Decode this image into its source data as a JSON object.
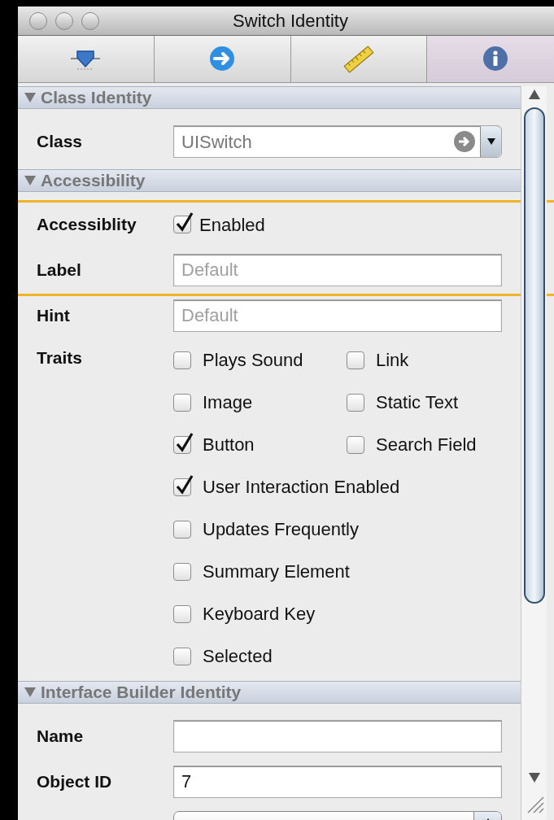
{
  "window": {
    "title": "Switch Identity"
  },
  "tabs": [
    {
      "kind": "connector",
      "selected": false
    },
    {
      "kind": "arrow",
      "selected": false
    },
    {
      "kind": "ruler",
      "selected": false
    },
    {
      "kind": "info",
      "selected": true
    }
  ],
  "sections": [
    {
      "title": "Class Identity",
      "expanded": true,
      "rows": [
        {
          "kind": "combo",
          "label": "Class",
          "value": "UISwitch"
        }
      ]
    },
    {
      "title": "Accessibility",
      "expanded": true,
      "rows": [
        {
          "kind": "highlight_group",
          "rows": [
            {
              "kind": "checkbox",
              "label": "Accessiblity",
              "option": "Enabled",
              "checked": true
            },
            {
              "kind": "text",
              "label": "Label",
              "placeholder": "Default"
            }
          ]
        },
        {
          "kind": "text",
          "label": "Hint",
          "placeholder": "Default"
        },
        {
          "kind": "traits",
          "label": "Traits",
          "lines": [
            [
              {
                "label": "Plays Sound",
                "checked": false
              },
              {
                "label": "Link",
                "checked": false
              }
            ],
            [
              {
                "label": "Image",
                "checked": false
              },
              {
                "label": "Static Text",
                "checked": false
              }
            ],
            [
              {
                "label": "Button",
                "checked": true
              },
              {
                "label": "Search Field",
                "checked": false
              }
            ],
            [
              {
                "label": "User Interaction Enabled",
                "checked": true
              }
            ],
            [
              {
                "label": "Updates Frequently",
                "checked": false
              }
            ],
            [
              {
                "label": "Summary Element",
                "checked": false
              }
            ],
            [
              {
                "label": "Keyboard Key",
                "checked": false
              }
            ],
            [
              {
                "label": "Selected",
                "checked": false
              }
            ]
          ]
        }
      ]
    },
    {
      "title": "Interface Builder Identity",
      "expanded": true,
      "rows": [
        {
          "kind": "text",
          "label": "Name",
          "value": ""
        },
        {
          "kind": "text",
          "label": "Object ID",
          "value": "7"
        },
        {
          "kind": "popup"
        }
      ]
    }
  ]
}
